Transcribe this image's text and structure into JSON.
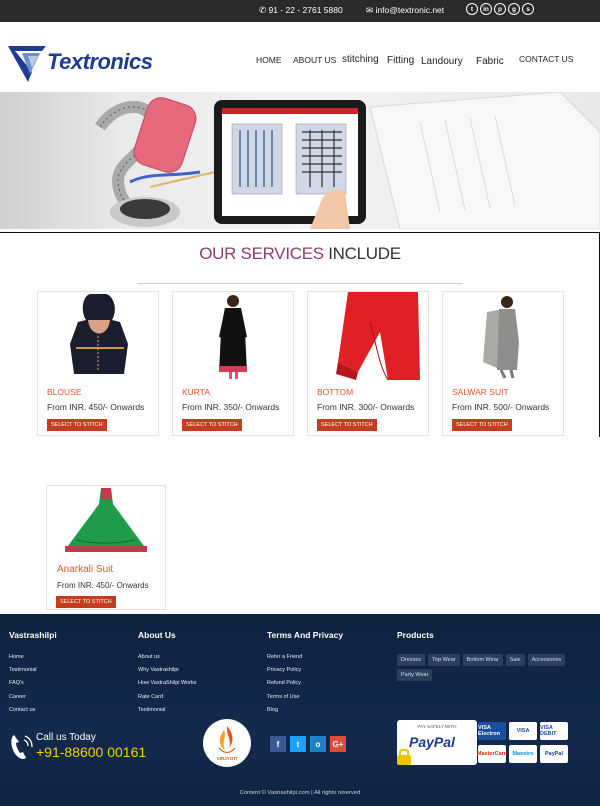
{
  "topbar": {
    "phone": "91 - 22 - 2761 5880",
    "email": "info@textronic.net",
    "social": [
      "twitter-icon",
      "linkedin-icon",
      "pinterest-icon",
      "google-plus-icon",
      "skype-icon"
    ]
  },
  "brand": {
    "name": "Textronics",
    "color": "#1f3a93"
  },
  "nav": [
    "HOME",
    "ABOUT US",
    "stitching",
    "Fitting",
    "Landoury",
    "Fabric",
    "CONTACT US"
  ],
  "services": {
    "title_a": "OUR SERVICES",
    "title_b": " INCLUDE",
    "cards": [
      {
        "name": "BLOUSE",
        "price": "From INR. 450/- Onwards",
        "button": "SELECT TO STITCH"
      },
      {
        "name": "KURTA",
        "price": "From INR. 350/- Onwards",
        "button": "SELECT TO STITCH"
      },
      {
        "name": "BOTTOM",
        "price": "From INR. 300/- Onwards",
        "button": "SELECT TO STITCH"
      },
      {
        "name": "SALWAR SUIT",
        "price": "From INR. 500/- Onwards",
        "button": "SELECT TO STITCH"
      }
    ],
    "extra_card": {
      "name": "Anarkali Suit",
      "price": "From INR. 450/- Onwards",
      "button": "SELECT TO STITCH"
    }
  },
  "footer": {
    "col1": {
      "title": "Vastrashilpi",
      "links": [
        "Home",
        "Testimonial",
        "FAQ's",
        "Career",
        "Contact us"
      ]
    },
    "col2": {
      "title": "About Us",
      "links": [
        "About us",
        "Why Vastrashilpi",
        "How VastraShilpi Works",
        "Rate Card",
        "Testimonial"
      ]
    },
    "col3": {
      "title": "Terms And Privacy",
      "links": [
        "Refer a Friend",
        "Privacy Policy",
        "Refund Policy",
        "Terms of Use",
        "Blog"
      ]
    },
    "col4": {
      "title": "Products",
      "tags": [
        "Dresses",
        "Top Wear",
        "Bottom Wear",
        "Sale",
        "Accessories",
        "Party Wear"
      ]
    },
    "call_label": "Call us Today",
    "call_number": "+91-88600 00161",
    "badge_text": "VIRJYOTI",
    "social": [
      "f",
      "t",
      "o",
      "G+"
    ],
    "paypal_small": "PAY SAFELY WITH",
    "paypal_text": "PayPal",
    "payment_cards": [
      "VISA Electron",
      "VISA",
      "VISA DEBIT",
      "MasterCard",
      "Maestro",
      "PayPal"
    ],
    "copyright": "Content © Vastrashilpi.com | All rights reserved"
  }
}
